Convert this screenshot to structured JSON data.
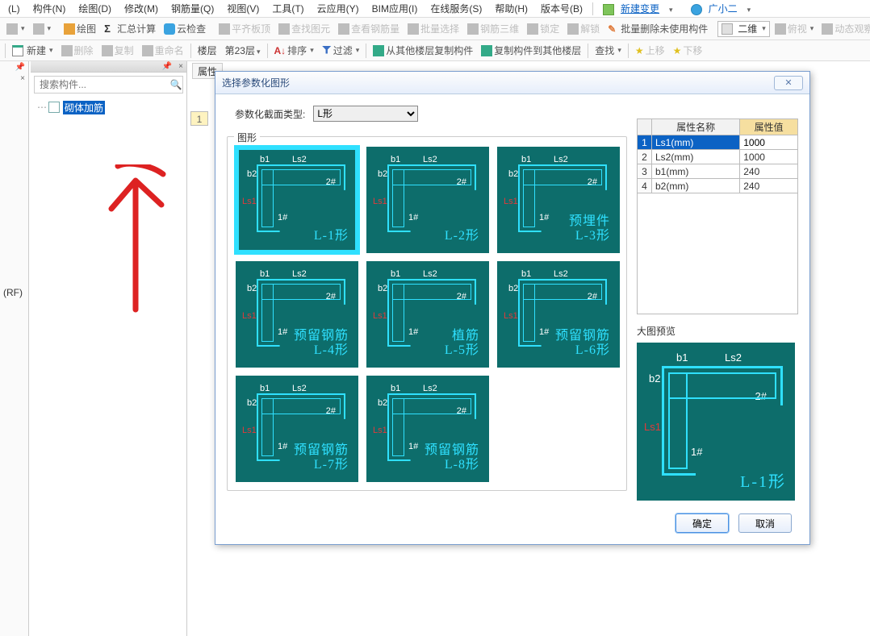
{
  "menubar": {
    "items": [
      "(L)",
      "构件(N)",
      "绘图(D)",
      "修改(M)",
      "钢筋量(Q)",
      "视图(V)",
      "工具(T)",
      "云应用(Y)",
      "BIM应用(I)",
      "在线服务(S)",
      "帮助(H)",
      "版本号(B)"
    ],
    "newchange": "新建变更",
    "user": "广小二"
  },
  "toolbar1": {
    "draw": "绘图",
    "sum": "汇总计算",
    "cloud": "云检查",
    "flat": "平齐板顶",
    "findgy": "查找图元",
    "chkrebar": "查看钢筋量",
    "batchsel": "批量选择",
    "rebar3d": "钢筋三维",
    "lock": "锁定",
    "unlock": "解锁",
    "batchdel": "批量删除未使用构件",
    "view2d": "二维",
    "fushi": "俯视",
    "dynobs": "动态观察"
  },
  "toolbar2": {
    "new": "新建",
    "del": "删除",
    "copy": "复制",
    "rename": "重命名",
    "floor": "楼层",
    "floorval": "第23层",
    "sort": "排序",
    "filter": "过滤",
    "copyfrom": "从其他楼层复制构件",
    "copyto": "复制构件到其他楼层",
    "find": "查找",
    "up": "上移",
    "down": "下移"
  },
  "leftstrip": {
    "label": ""
  },
  "tree": {
    "search_ph": "搜索构件...",
    "node": "砌体加筋"
  },
  "proptab": "属性",
  "row1": "1",
  "dialog": {
    "title": "选择参数化图形",
    "type_lbl": "参数化截面类型:",
    "type_val": "L形",
    "shapes_lbl": "图形",
    "shapes": [
      {
        "name": "L-1形",
        "sub": ""
      },
      {
        "name": "L-2形",
        "sub": ""
      },
      {
        "name": "L-3形",
        "sub": "预埋件"
      },
      {
        "name": "L-4形",
        "sub": "预留钢筋"
      },
      {
        "name": "L-5形",
        "sub": "植筋"
      },
      {
        "name": "L-6形",
        "sub": "预留钢筋"
      },
      {
        "name": "L-7形",
        "sub": "预留钢筋"
      },
      {
        "name": "L-8形",
        "sub": "预留钢筋"
      }
    ],
    "hints": {
      "b1": "b1",
      "ls2": "Ls2",
      "b2": "b2",
      "ls1": "Ls1",
      "n1": "1#",
      "n2": "2#"
    },
    "attr_name": "属性名称",
    "attr_val": "属性值",
    "attrs": [
      {
        "k": "Ls1(mm)",
        "v": "1000"
      },
      {
        "k": "Ls2(mm)",
        "v": "1000"
      },
      {
        "k": "b1(mm)",
        "v": "240"
      },
      {
        "k": "b2(mm)",
        "v": "240"
      }
    ],
    "preview_lbl": "大图预览",
    "preview_name": "L-1形",
    "ok": "确定",
    "cancel": "取消"
  },
  "rf": "(RF)"
}
